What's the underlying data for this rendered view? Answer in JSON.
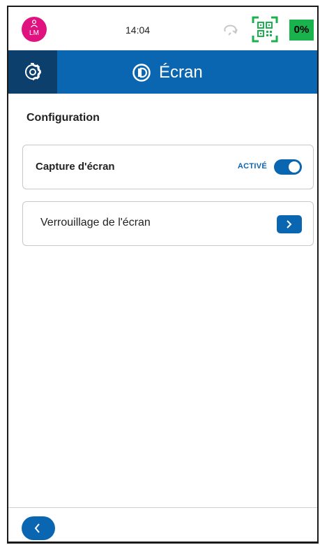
{
  "status": {
    "avatar_initials": "LM",
    "time": "14:04",
    "battery": "0%",
    "colors": {
      "avatar": "#e0127f",
      "battery": "#1ab24c",
      "qr": "#1ab24c"
    }
  },
  "header": {
    "title": "Écran",
    "colors": {
      "bar": "#0a66b0",
      "gear_bg": "#0c3f6b"
    }
  },
  "section": {
    "title": "Configuration"
  },
  "items": [
    {
      "label": "Capture d'écran",
      "state": "ACTIVÉ",
      "enabled": true
    },
    {
      "label": "Verrouillage de l'écran"
    }
  ],
  "icons": {
    "avatar": "person-icon",
    "sync": "sync-icon",
    "qr": "qr-code-icon",
    "gear": "gear-icon",
    "title": "display-icon",
    "arrow": "chevron-right-icon",
    "back": "chevron-left-icon"
  }
}
